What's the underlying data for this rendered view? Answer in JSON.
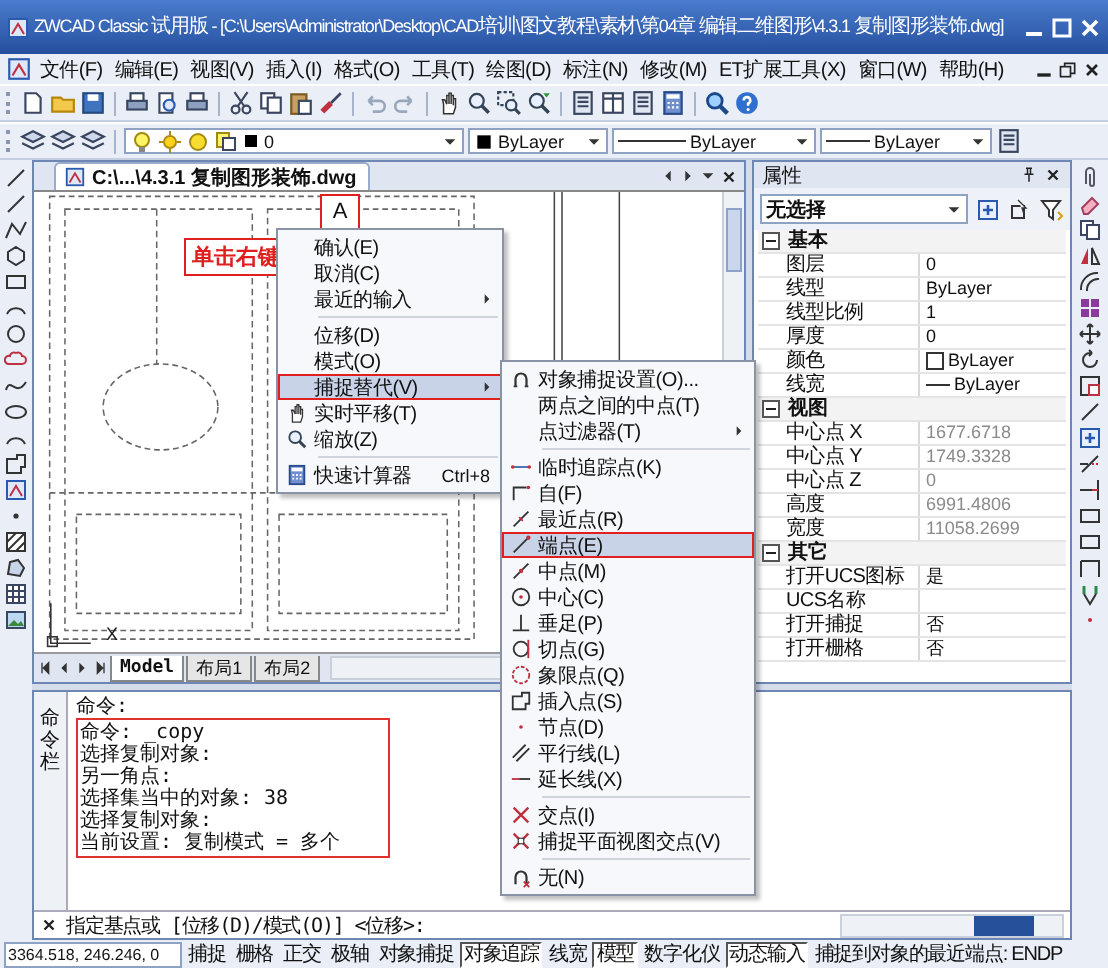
{
  "window": {
    "title": "ZWCAD Classic 试用版 - [C:\\Users\\Administrator\\Desktop\\CAD培训\\图文教程\\素材\\第04章 编辑二维图形\\4.3.1 复制图形装饰.dwg]"
  },
  "menu_bar": [
    "文件(F)",
    "编辑(E)",
    "视图(V)",
    "插入(I)",
    "格式(O)",
    "工具(T)",
    "绘图(D)",
    "标注(N)",
    "修改(M)",
    "ET扩展工具(X)",
    "窗口(W)",
    "帮助(H)"
  ],
  "layer_toolbar": {
    "layer": "0",
    "color_control": "ByLayer",
    "linetype": "ByLayer",
    "lineweight": "ByLayer"
  },
  "document": {
    "tab_title": "C:\\...\\4.3.1  复制图形装饰.dwg",
    "ucs_axis_label": "X",
    "layout_tabs": [
      {
        "label": "Model",
        "selected": true
      },
      {
        "label": "布局1",
        "selected": false
      },
      {
        "label": "布局2",
        "selected": false
      }
    ]
  },
  "callouts": {
    "marker": "A",
    "note": "单击右键"
  },
  "context_menu": [
    {
      "kind": "item",
      "label": "确认(E)",
      "submenu": false,
      "selected": false
    },
    {
      "kind": "item",
      "label": "取消(C)",
      "submenu": false,
      "selected": false
    },
    {
      "kind": "item",
      "label": "最近的输入",
      "submenu": true,
      "selected": false
    },
    {
      "kind": "separator"
    },
    {
      "kind": "item",
      "label": "位移(D)",
      "submenu": false,
      "selected": false
    },
    {
      "kind": "item",
      "label": "模式(O)",
      "submenu": false,
      "selected": false
    },
    {
      "kind": "item",
      "label": "捕捉替代(V)",
      "submenu": true,
      "selected": true
    },
    {
      "kind": "item",
      "label": "实时平移(T)",
      "submenu": false,
      "selected": false
    },
    {
      "kind": "item",
      "label": "缩放(Z)",
      "submenu": false,
      "selected": false
    },
    {
      "kind": "separator"
    },
    {
      "kind": "item",
      "label": "快速计算器",
      "shortcut": "Ctrl+8",
      "submenu": false,
      "selected": false
    }
  ],
  "snap_submenu": [
    {
      "kind": "item",
      "label": "对象捕捉设置(O)...",
      "submenu": false,
      "selected": false
    },
    {
      "kind": "item",
      "label": "两点之间的中点(T)",
      "submenu": false,
      "selected": false
    },
    {
      "kind": "item",
      "label": "点过滤器(T)",
      "submenu": true,
      "selected": false
    },
    {
      "kind": "separator"
    },
    {
      "kind": "item",
      "label": "临时追踪点(K)",
      "submenu": false,
      "selected": false
    },
    {
      "kind": "item",
      "label": "自(F)",
      "submenu": false,
      "selected": false
    },
    {
      "kind": "item",
      "label": "最近点(R)",
      "submenu": false,
      "selected": false
    },
    {
      "kind": "item",
      "label": "端点(E)",
      "submenu": false,
      "selected": true
    },
    {
      "kind": "item",
      "label": "中点(M)",
      "submenu": false,
      "selected": false
    },
    {
      "kind": "item",
      "label": "中心(C)",
      "submenu": false,
      "selected": false
    },
    {
      "kind": "item",
      "label": "垂足(P)",
      "submenu": false,
      "selected": false
    },
    {
      "kind": "item",
      "label": "切点(G)",
      "submenu": false,
      "selected": false
    },
    {
      "kind": "item",
      "label": "象限点(Q)",
      "submenu": false,
      "selected": false
    },
    {
      "kind": "item",
      "label": "插入点(S)",
      "submenu": false,
      "selected": false
    },
    {
      "kind": "item",
      "label": "节点(D)",
      "submenu": false,
      "selected": false
    },
    {
      "kind": "item",
      "label": "平行线(L)",
      "submenu": false,
      "selected": false
    },
    {
      "kind": "item",
      "label": "延长线(X)",
      "submenu": false,
      "selected": false
    },
    {
      "kind": "separator"
    },
    {
      "kind": "item",
      "label": "交点(I)",
      "submenu": false,
      "selected": false
    },
    {
      "kind": "item",
      "label": "捕捉平面视图交点(V)",
      "submenu": false,
      "selected": false
    },
    {
      "kind": "separator"
    },
    {
      "kind": "item",
      "label": "无(N)",
      "submenu": false,
      "selected": false
    }
  ],
  "properties_panel": {
    "title": "属性",
    "selection": "无选择",
    "groups": [
      {
        "name": "基本",
        "expanded": true,
        "rows": [
          {
            "kind": "text",
            "name": "图层",
            "value": "0",
            "readonly": false
          },
          {
            "kind": "text",
            "name": "线型",
            "value": "ByLayer",
            "readonly": false
          },
          {
            "kind": "text",
            "name": "线型比例",
            "value": "1",
            "readonly": false
          },
          {
            "kind": "text",
            "name": "厚度",
            "value": "0",
            "readonly": false
          },
          {
            "kind": "color",
            "name": "颜色",
            "value": "ByLayer",
            "readonly": false
          },
          {
            "kind": "lineweight",
            "name": "线宽",
            "value": "ByLayer",
            "readonly": false
          }
        ]
      },
      {
        "name": "视图",
        "expanded": true,
        "rows": [
          {
            "kind": "text",
            "name": "中心点 X",
            "value": "1677.6718",
            "readonly": true
          },
          {
            "kind": "text",
            "name": "中心点 Y",
            "value": "1749.3328",
            "readonly": true
          },
          {
            "kind": "text",
            "name": "中心点 Z",
            "value": "0",
            "readonly": true
          },
          {
            "kind": "text",
            "name": "高度",
            "value": "6991.4806",
            "readonly": true
          },
          {
            "kind": "text",
            "name": "宽度",
            "value": "11058.2699",
            "readonly": true
          }
        ]
      },
      {
        "name": "其它",
        "expanded": true,
        "rows": [
          {
            "kind": "text",
            "name": "打开UCS图标",
            "value": "是",
            "readonly": false
          },
          {
            "kind": "text",
            "name": "UCS名称",
            "readonly": false
          },
          {
            "kind": "text",
            "name": "打开捕捉",
            "value": "否",
            "readonly": false
          },
          {
            "kind": "text",
            "name": "打开栅格",
            "value": "否",
            "readonly": false
          }
        ]
      }
    ]
  },
  "command_panel": {
    "label": "命令栏",
    "history": [
      {
        "text": "命令:",
        "boxed": false
      },
      {
        "text": "命令: _copy",
        "boxed": true
      },
      {
        "text": "选择复制对象:",
        "boxed": true
      },
      {
        "text": "另一角点:",
        "boxed": true
      },
      {
        "text": "选择集当中的对象: 38",
        "boxed": true
      },
      {
        "text": "选择复制对象:",
        "boxed": true
      },
      {
        "text": "当前设置: 复制模式 = 多个",
        "boxed": true
      }
    ],
    "prompt": "指定基点或 [位移(D)/模式(O)] <位移>:"
  },
  "status_bar": {
    "coordinates": "3364.518, 246.246, 0",
    "toggles": [
      {
        "label": "捕捉",
        "on": false
      },
      {
        "label": "栅格",
        "on": false
      },
      {
        "label": "正交",
        "on": false
      },
      {
        "label": "极轴",
        "on": false
      },
      {
        "label": "对象捕捉",
        "on": false
      },
      {
        "label": "对象追踪",
        "on": true
      },
      {
        "label": "线宽",
        "on": false
      },
      {
        "label": "模型",
        "on": true
      },
      {
        "label": "数字化仪",
        "on": false
      },
      {
        "label": "动态输入",
        "on": true
      }
    ],
    "message": "捕捉到对象的最近端点: ENDP"
  }
}
